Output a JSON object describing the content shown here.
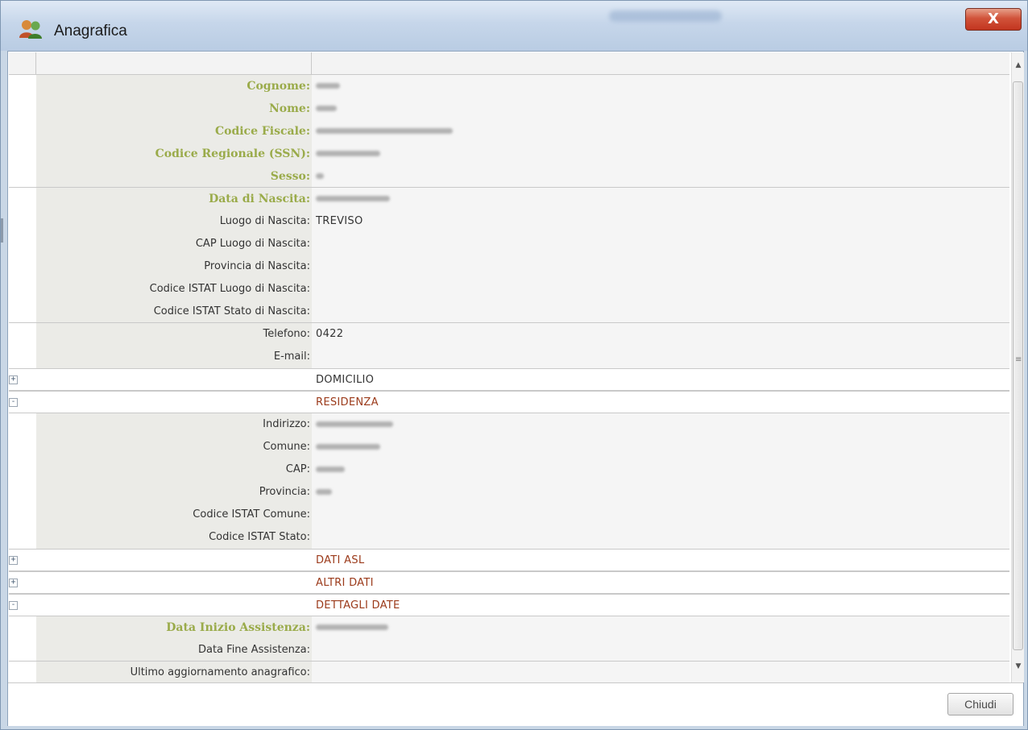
{
  "window": {
    "title": "Anagrafica",
    "close_glyph": "X",
    "icon": "people-icon",
    "accent": "#9aab4a",
    "section_color": "#9b3a1a"
  },
  "rows": [
    {
      "label": "Cognome:",
      "value": "",
      "redacted_width": 30,
      "green": true
    },
    {
      "label": "Nome:",
      "value": "",
      "redacted_width": 26,
      "green": true
    },
    {
      "label": "Codice Fiscale:",
      "value": "",
      "redacted_width": 170,
      "green": true
    },
    {
      "label": "Codice Regionale (SSN):",
      "value": "",
      "redacted_width": 80,
      "green": true
    },
    {
      "label": "Sesso:",
      "value": "",
      "redacted_width": 10,
      "green": true,
      "group_end": true
    },
    {
      "label": "Data di Nascita:",
      "value": "",
      "redacted_width": 92,
      "green": true
    },
    {
      "label": "Luogo di Nascita:",
      "value": "TREVISO"
    },
    {
      "label": "CAP Luogo di Nascita:",
      "value": ""
    },
    {
      "label": "Provincia di Nascita:",
      "value": ""
    },
    {
      "label": "Codice ISTAT Luogo di Nascita:",
      "value": ""
    },
    {
      "label": "Codice ISTAT Stato di Nascita:",
      "value": "",
      "group_end": true
    },
    {
      "label": "Telefono:",
      "value": "0422"
    },
    {
      "label": "E-mail:",
      "value": ""
    },
    {
      "section": true,
      "toggle": "+",
      "value": "DOMICILIO",
      "brown": false
    },
    {
      "section": true,
      "toggle": "-",
      "value": "RESIDENZA",
      "brown": true
    },
    {
      "label": "Indirizzo:",
      "value": "",
      "redacted_width": 96
    },
    {
      "label": "Comune:",
      "value": "",
      "redacted_width": 80
    },
    {
      "label": "CAP:",
      "value": "",
      "redacted_width": 36
    },
    {
      "label": "Provincia:",
      "value": "",
      "redacted_width": 20
    },
    {
      "label": "Codice ISTAT Comune:",
      "value": ""
    },
    {
      "label": "Codice ISTAT Stato:",
      "value": ""
    },
    {
      "section": true,
      "toggle": "+",
      "value": "DATI ASL",
      "brown": true
    },
    {
      "section": true,
      "toggle": "+",
      "value": "ALTRI DATI",
      "brown": true
    },
    {
      "section": true,
      "toggle": "-",
      "value": "DETTAGLI DATE",
      "brown": true
    },
    {
      "label": "Data Inizio Assistenza:",
      "value": "",
      "redacted_width": 90,
      "green": true
    },
    {
      "label": "Data Fine Assistenza:",
      "value": "",
      "group_end": true
    },
    {
      "label": "Ultimo aggiornamento anagrafico:",
      "value": ""
    }
  ],
  "footer": {
    "close_label": "Chiudi"
  }
}
